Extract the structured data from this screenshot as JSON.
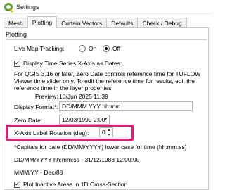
{
  "window": {
    "title": "Settings"
  },
  "tabs": [
    {
      "label": "Mesh"
    },
    {
      "label": "Plotting"
    },
    {
      "label": "Curtain Vectors"
    },
    {
      "label": "Defaults"
    },
    {
      "label": "Check / Debug"
    }
  ],
  "plotting": {
    "section_title": "Plotting",
    "live_map_tracking": {
      "label": "Live Map Tracking:",
      "on": "On",
      "off": "Off",
      "selected": "Off"
    },
    "display_time_series_dates": {
      "label": "Display Time Series X-Axis as Dates:",
      "checked": true
    },
    "note_qgis": "For QGIS 3.16 or later, Zero Date controls reference time for TUFLOW Viewer time slider only. To edit the reference time for results, edit the reference time in the layer properties.",
    "preview": {
      "label": "Preview:",
      "value": "10/Jun 2025 11:39"
    },
    "display_format": {
      "label": "Display Format*:",
      "value": "DD/MMM YYY hh:mm"
    },
    "zero_date": {
      "label": "Zero Date:",
      "value": "12/03/1999 2:00"
    },
    "x_axis_rotation": {
      "label": "X-Axis Label Rotation (deg):",
      "value": "0"
    },
    "capitals_note": "*Capitals for date (DD/MM/YYYY) lower case for time (hh:mm:ss)",
    "example1": "DD/MM/YYYY hh:mm:ss - 31/12/1988 12:00:00",
    "example2": "MMM/YY - Dec/88",
    "plot_inactive": {
      "label": "Plot Inactive Areas in 1D Cross-Section",
      "checked": true
    }
  },
  "colors": {
    "highlight": "#e5197a"
  }
}
